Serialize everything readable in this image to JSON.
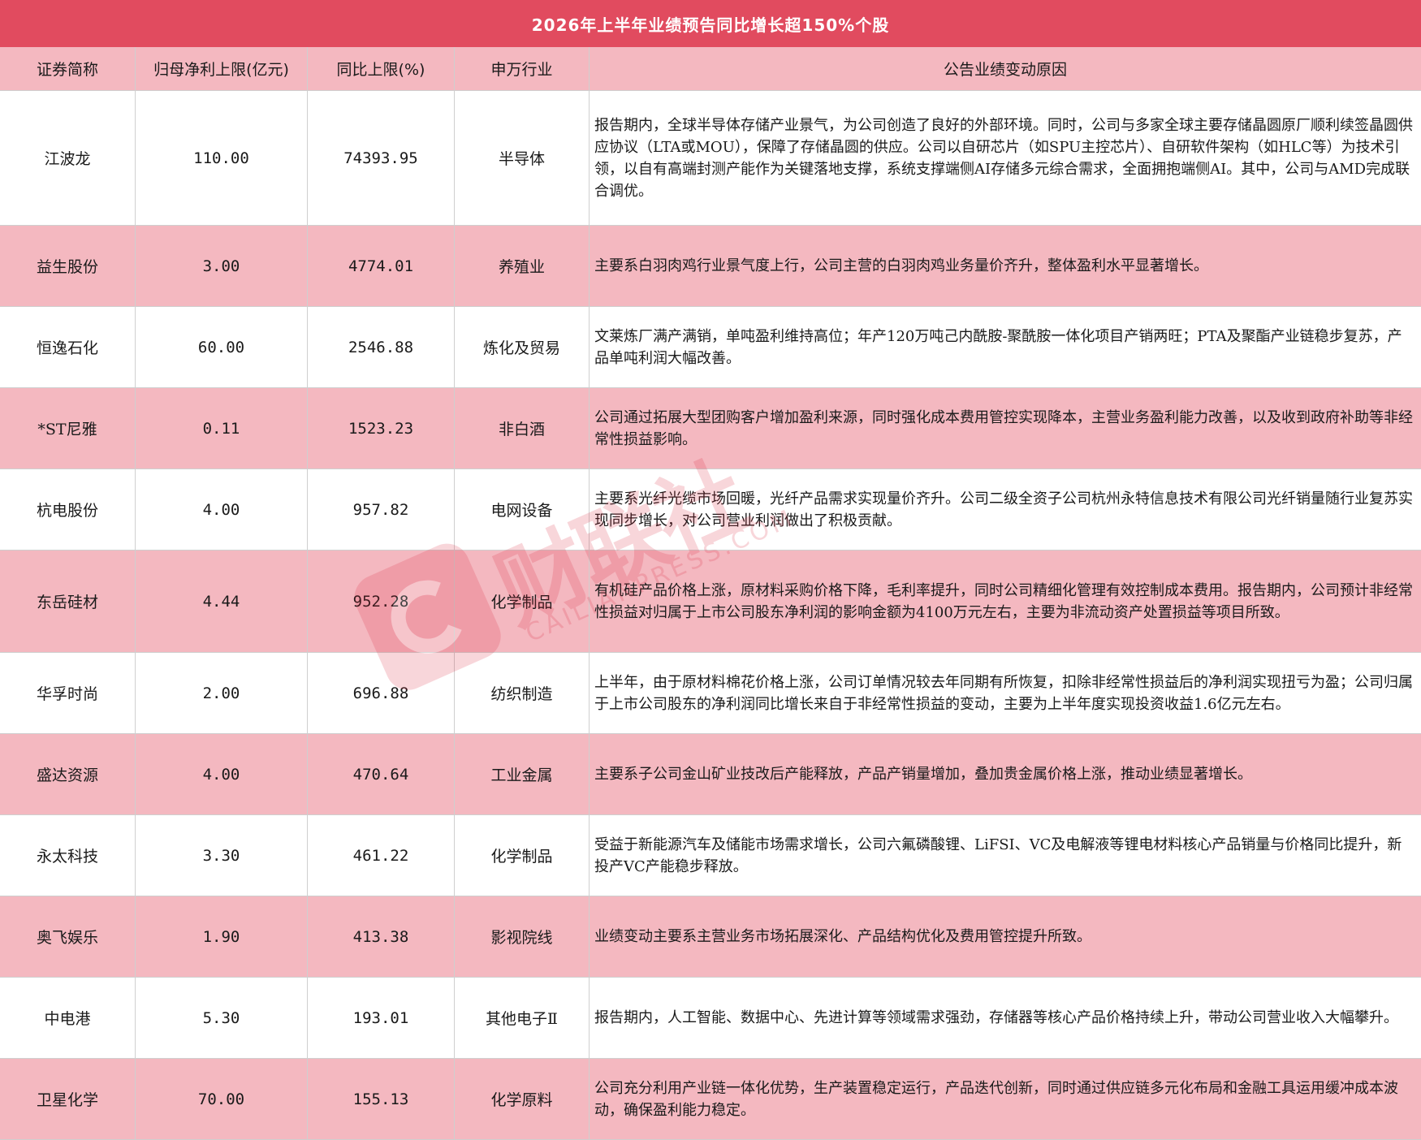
{
  "title": "2026年上半年业绩预告同比增长超150%个股",
  "columns": [
    "证券简称",
    "归母净利上限(亿元)",
    "同比上限(%)",
    "申万行业",
    "公告业绩变动原因"
  ],
  "rows": [
    {
      "name": "江波龙",
      "profit": "110.00",
      "yoy": "74393.95",
      "industry": "半导体",
      "reason": "报告期内，全球半导体存储产业景气，为公司创造了良好的外部环境。同时，公司与多家全球主要存储晶圆原厂顺利续签晶圆供应协议（LTA或MOU），保障了存储晶圆的供应。公司以自研芯片（如SPU主控芯片）、自研软件架构（如HLC等）为技术引领，以自有高端封测产能作为关键落地支撑，系统支撑端侧AI存储多元综合需求，全面拥抱端侧AI。其中，公司与AMD完成联合调优。"
    },
    {
      "name": "益生股份",
      "profit": "3.00",
      "yoy": "4774.01",
      "industry": "养殖业",
      "reason": "主要系白羽肉鸡行业景气度上行，公司主营的白羽肉鸡业务量价齐升，整体盈利水平显著增长。"
    },
    {
      "name": "恒逸石化",
      "profit": "60.00",
      "yoy": "2546.88",
      "industry": "炼化及贸易",
      "reason": "文莱炼厂满产满销，单吨盈利维持高位；年产120万吨己内酰胺-聚酰胺一体化项目产销两旺；PTA及聚酯产业链稳步复苏，产品单吨利润大幅改善。"
    },
    {
      "name": "*ST尼雅",
      "profit": "0.11",
      "yoy": "1523.23",
      "industry": "非白酒",
      "reason": "公司通过拓展大型团购客户增加盈利来源，同时强化成本费用管控实现降本，主营业务盈利能力改善，以及收到政府补助等非经常性损益影响。"
    },
    {
      "name": "杭电股份",
      "profit": "4.00",
      "yoy": "957.82",
      "industry": "电网设备",
      "reason": "主要系光纤光缆市场回暖，光纤产品需求实现量价齐升。公司二级全资子公司杭州永特信息技术有限公司光纤销量随行业复苏实现同步增长，对公司营业利润做出了积极贡献。"
    },
    {
      "name": "东岳硅材",
      "profit": "4.44",
      "yoy": "952.28",
      "industry": "化学制品",
      "reason": "有机硅产品价格上涨，原材料采购价格下降，毛利率提升，同时公司精细化管理有效控制成本费用。报告期内，公司预计非经常性损益对归属于上市公司股东净利润的影响金额为4100万元左右，主要为非流动资产处置损益等项目所致。"
    },
    {
      "name": "华孚时尚",
      "profit": "2.00",
      "yoy": "696.88",
      "industry": "纺织制造",
      "reason": "上半年，由于原材料棉花价格上涨，公司订单情况较去年同期有所恢复，扣除非经常性损益后的净利润实现扭亏为盈；公司归属于上市公司股东的净利润同比增长来自于非经常性损益的变动，主要为上半年度实现投资收益1.6亿元左右。"
    },
    {
      "name": "盛达资源",
      "profit": "4.00",
      "yoy": "470.64",
      "industry": "工业金属",
      "reason": "主要系子公司金山矿业技改后产能释放，产品产销量增加，叠加贵金属价格上涨，推动业绩显著增长。"
    },
    {
      "name": "永太科技",
      "profit": "3.30",
      "yoy": "461.22",
      "industry": "化学制品",
      "reason": "受益于新能源汽车及储能市场需求增长，公司六氟磷酸锂、LiFSI、VC及电解液等锂电材料核心产品销量与价格同比提升，新投产VC产能稳步释放。"
    },
    {
      "name": "奥飞娱乐",
      "profit": "1.90",
      "yoy": "413.38",
      "industry": "影视院线",
      "reason": "业绩变动主要系主营业务市场拓展深化、产品结构优化及费用管控提升所致。"
    },
    {
      "name": "中电港",
      "profit": "5.30",
      "yoy": "193.01",
      "industry": "其他电子Ⅱ",
      "reason": "报告期内，人工智能、数据中心、先进计算等领域需求强劲，存储器等核心产品价格持续上升，带动公司营业收入大幅攀升。"
    },
    {
      "name": "卫星化学",
      "profit": "70.00",
      "yoy": "155.13",
      "industry": "化学原料",
      "reason": "公司充分利用产业链一体化优势，生产装置稳定运行，产品迭代创新，同时通过供应链多元化布局和金融工具运用缓冲成本波动，确保盈利能力稳定。"
    }
  ],
  "watermark": {
    "text": "财联社",
    "sub": "CAILIANPRESS.COM"
  }
}
